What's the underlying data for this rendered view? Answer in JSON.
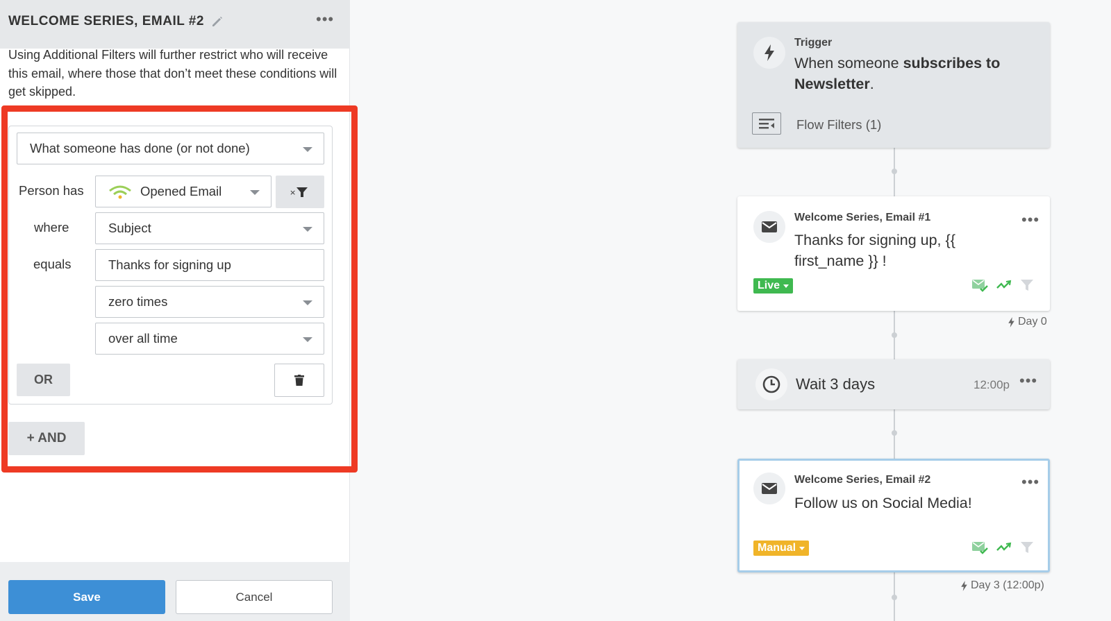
{
  "panel": {
    "title": "WELCOME SERIES, EMAIL #2",
    "intro": "Using Additional Filters will further restrict who will receive this email, where those that don’t meet these conditions will get skipped."
  },
  "filter": {
    "condition_type": "What someone has done (or not done)",
    "person_has_label": "Person has",
    "metric": "Opened Email",
    "where_label": "where",
    "property": "Subject",
    "equals_label": "equals",
    "value": "Thanks for signing up",
    "frequency": "zero times",
    "timeframe": "over all time",
    "or_label": "OR",
    "and_label": "+ AND"
  },
  "footer": {
    "save_label": "Save",
    "cancel_label": "Cancel"
  },
  "flow": {
    "trigger": {
      "label": "Trigger",
      "text_prefix": "When someone ",
      "text_bold": "subscribes to Newsletter",
      "text_suffix": ".",
      "filters_label": "Flow Filters (1)"
    },
    "email1": {
      "name": "Welcome Series, Email #1",
      "subject": "Thanks for signing up, {{ first_name }} !",
      "status": "Live",
      "status_color": "#3fb950",
      "day": "Day 0"
    },
    "wait": {
      "text": "Wait 3 days",
      "time": "12:00p"
    },
    "email2": {
      "name": "Welcome Series, Email #2",
      "subject": "Follow us on Social Media!",
      "status": "Manual",
      "status_color": "#f0b429",
      "day": "Day 3 (12:00p)"
    }
  },
  "colors": {
    "accent": "#3d8fd6",
    "highlight": "#ee3a24"
  }
}
